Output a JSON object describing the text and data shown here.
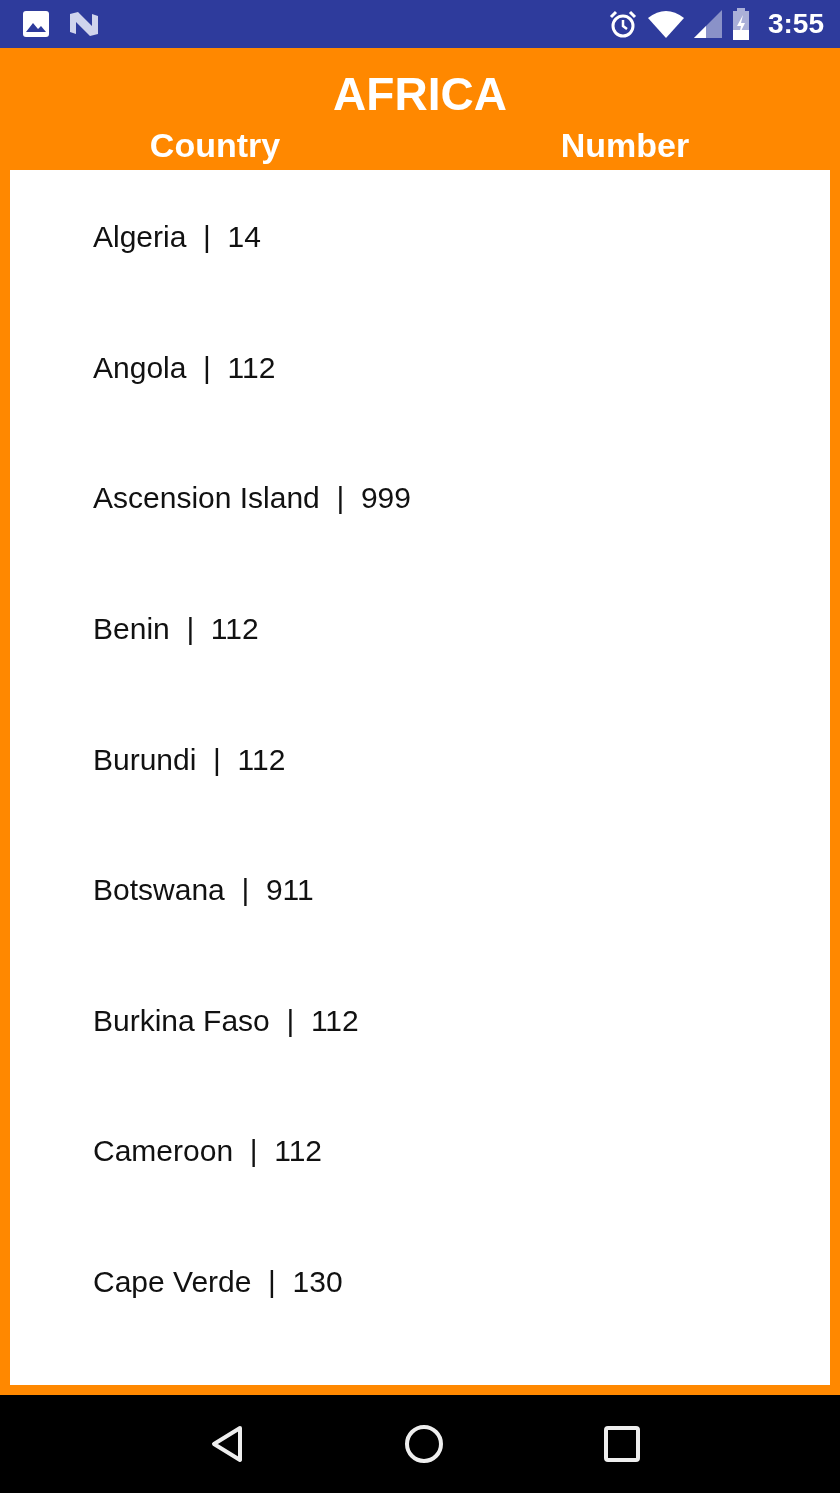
{
  "status_bar": {
    "time": "3:55"
  },
  "header": {
    "title": "AFRICA",
    "columns": [
      "Country",
      "Number"
    ]
  },
  "rows": [
    {
      "text": "Algeria  |  14"
    },
    {
      "text": "Angola  |  112"
    },
    {
      "text": "Ascension Island  |  999"
    },
    {
      "text": "Benin  |  112"
    },
    {
      "text": "Burundi  |  112"
    },
    {
      "text": "Botswana  |  911"
    },
    {
      "text": "Burkina Faso  |  112"
    },
    {
      "text": "Cameroon  |  112"
    },
    {
      "text": "Cape Verde  |  130"
    }
  ]
}
